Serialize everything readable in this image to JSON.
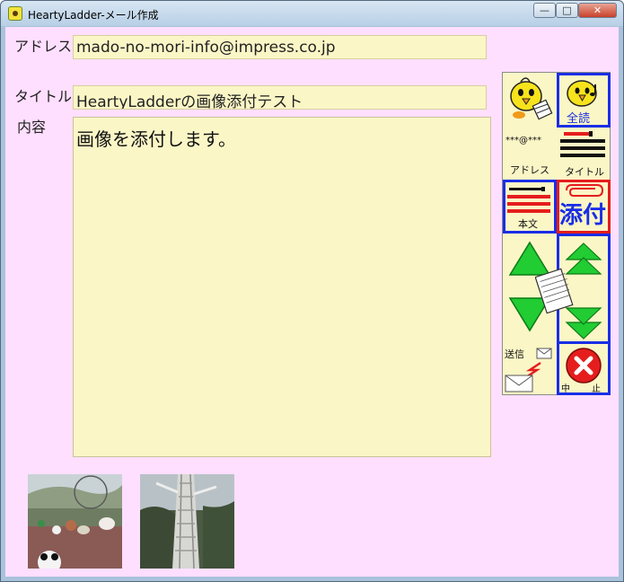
{
  "window": {
    "title": "HeartyLadder-メール作成"
  },
  "form": {
    "address_label": "アドレス",
    "address_value": "mado-no-mori-info@impress.co.jp",
    "title_label": "タイトル",
    "title_value": "HeartyLadderの画像添付テスト",
    "content_label": "内容",
    "content_value": "画像を添付します。"
  },
  "panel": {
    "read_all_label": "全読",
    "address_mask": "***@***",
    "address_button_label": "アドレス",
    "title_button_label": "タイトル",
    "body_button_label": "本文",
    "attach_label": "添付",
    "send_label": "送信",
    "cancel_label": "中止"
  },
  "attachments": [
    {
      "name": "attachment-photo-1"
    },
    {
      "name": "attachment-photo-2"
    }
  ],
  "colors": {
    "background": "#ffdfff",
    "field": "#fbf6c6",
    "accent_blue": "#1a2ee6",
    "accent_red": "#e51d1d",
    "arrow_green": "#22cc33"
  }
}
